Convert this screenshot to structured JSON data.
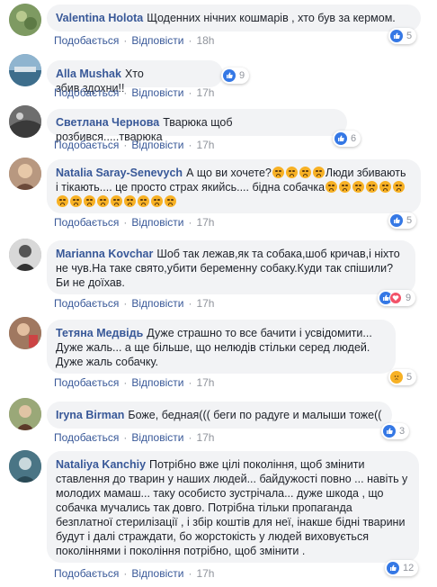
{
  "actions": {
    "like": "Подобається",
    "reply": "Відповісти",
    "sep": "·"
  },
  "comments": [
    {
      "author": "Valentina Holota",
      "text": "Щоденних нічних кошмарів , хто був за кермом.",
      "time": "18h",
      "reactions": "5",
      "avatar_color": "#6f8a57"
    },
    {
      "author": "Alla Mushak",
      "text": "Хто збив,здохни!!",
      "time": "17h",
      "reactions": "9",
      "avatar_color": "#4c7fa0"
    },
    {
      "author": "Светлана Чернова",
      "text": "Тварюка щоб розбився.....тварюка",
      "time": "17h",
      "reactions": "6",
      "avatar_color": "#5a5a5a"
    },
    {
      "author": "Natalia Saray-Senevych",
      "text_a": "А що ви хочете?",
      "text_b": "Люди збивають і тікають.... це просто страх якийсь.... бідна собачка",
      "time": "17h",
      "reactions": "5",
      "avatar_color": "#8a6b5a"
    },
    {
      "author": "Marianna Kovchar",
      "text": "Шоб так лежав,як та собака,шоб кричав,і ніхто не чув.На таке свято,убити беременну собаку.Куди так спішили? Би не доїхав.",
      "time": "17h",
      "reactions": "9",
      "avatar_color": "#9a9a9a"
    },
    {
      "author": "Тетяна Медвідь",
      "text": "Дуже страшно то все бачити і усвідомити... Дуже жаль... а ще більше, що нелюдів стільки серед людей. Дуже жаль собачку.",
      "time": "17h",
      "reactions": "5",
      "avatar_color": "#7a5c4a"
    },
    {
      "author": "Iryna Birman",
      "text": "Боже, бедная((( беги по радуге и малыши тоже((",
      "time": "17h",
      "reactions": "3",
      "avatar_color": "#7b8a60"
    },
    {
      "author": "Nataliya Kanchiy",
      "text": "Потрібно вже цілі покоління, щоб змінити ставлення до тварин у наших людей... байдужості повно ... навіть у молодих мамаш... таку особисто зустрічала... дуже шкода , що собачка мучались так довго. Потрібна тільки пропаганда безплатної стерилізації , і збір коштів для неї, інакше бідні тварини будут і далі страждати, бо жорстокість у людей виховується поколіннями і покоління потрібно, щоб змінити .",
      "time": "17h",
      "reactions": "12",
      "avatar_color": "#3d5f6e"
    }
  ],
  "colors": {
    "link": "#385898",
    "like_blue": "#3578e5",
    "love_red": "#f25268",
    "bubble": "#f2f3f5"
  }
}
